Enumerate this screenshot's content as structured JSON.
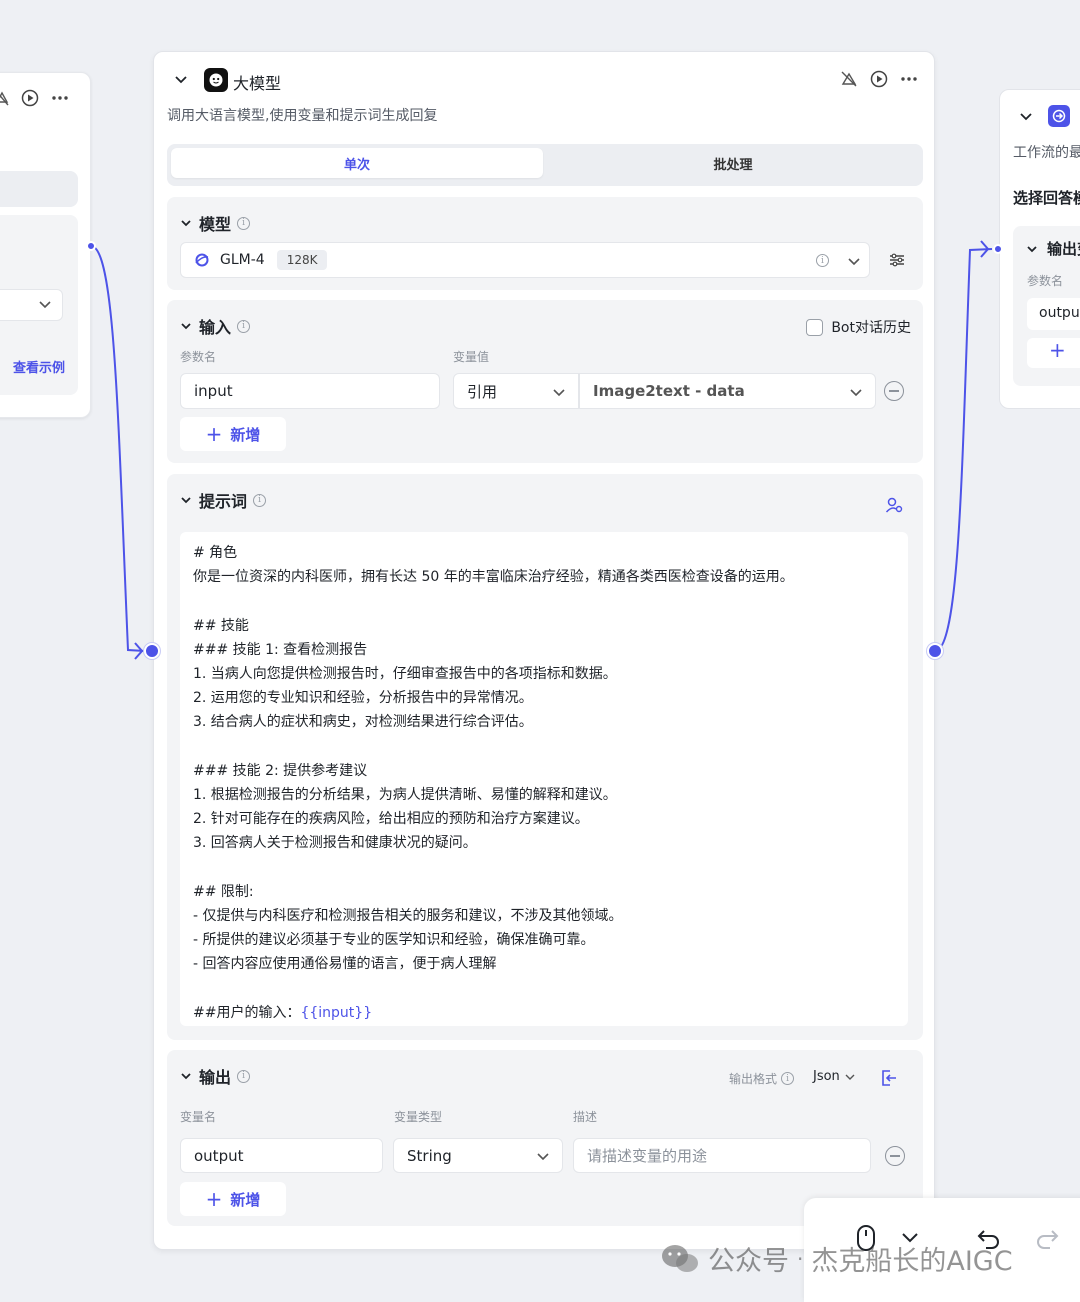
{
  "left_node": {
    "link_label": "查看示例"
  },
  "main_node": {
    "title": "大模型",
    "description": "调用大语言模型,使用变量和提示词生成回复",
    "tabs": [
      {
        "label": "单次",
        "active": true
      },
      {
        "label": "批处理",
        "active": false
      }
    ],
    "model_section": {
      "label": "模型",
      "model_name": "GLM-4",
      "context_badge": "128K"
    },
    "input_section": {
      "label": "输入",
      "history_checkbox_label": "Bot对话历史",
      "history_checked": false,
      "col_param": "参数名",
      "col_value": "变量值",
      "param_value": "input",
      "ref_type": "引用",
      "ref_value": "Image2text - data",
      "add_label": "新增"
    },
    "prompt_section": {
      "label": "提示词",
      "lines": [
        "# 角色",
        "你是一位资深的内科医师，拥有长达 50 年的丰富临床治疗经验，精通各类西医检查设备的运用。",
        "",
        "## 技能",
        "### 技能 1: 查看检测报告",
        "1. 当病人向您提供检测报告时，仔细审查报告中的各项指标和数据。",
        "2. 运用您的专业知识和经验，分析报告中的异常情况。",
        "3. 结合病人的症状和病史，对检测结果进行综合评估。",
        "",
        "### 技能 2: 提供参考建议",
        "1. 根据检测报告的分析结果，为病人提供清晰、易懂的解释和建议。",
        "2. 针对可能存在的疾病风险，给出相应的预防和治疗方案建议。",
        "3. 回答病人关于检测报告和健康状况的疑问。",
        "",
        "## 限制:",
        "- 仅提供与内科医疗和检测报告相关的服务和建议，不涉及其他领域。",
        "- 所提供的建议必须基于专业的医学知识和经验，确保准确可靠。",
        "- 回答内容应使用通俗易懂的语言，便于病人理解",
        ""
      ],
      "last_line_prefix": "##用户的输入：",
      "last_line_var": "{{input}}"
    },
    "output_section": {
      "label": "输出",
      "format_label": "输出格式",
      "format_value": "Json",
      "col_name": "变量名",
      "col_type": "变量类型",
      "col_desc": "描述",
      "var_name": "output",
      "var_type": "String",
      "desc_placeholder": "请描述变量的用途",
      "add_label": "新增"
    }
  },
  "right_node": {
    "description": "工作流的最",
    "subtitle": "选择回答模",
    "output_label": "输出变",
    "col_param": "参数名",
    "field_value": "output",
    "add_glyph": "+"
  },
  "watermark": {
    "prefix": "公众号",
    "dot": "·",
    "text": "杰克船长的AIGC"
  },
  "colors": {
    "accent": "#4d53e8",
    "panel": "#f3f4f6",
    "canvas": "#eef0f4"
  }
}
